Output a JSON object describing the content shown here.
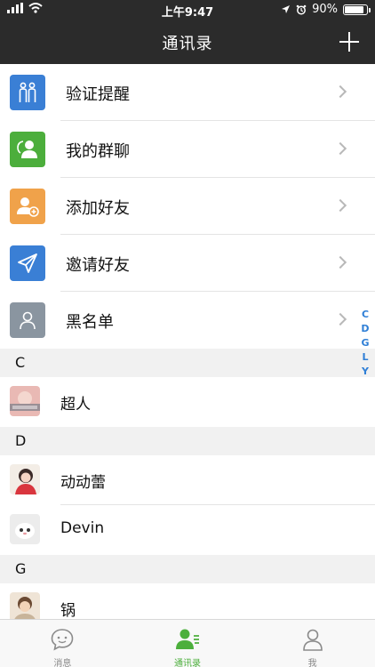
{
  "status_bar": {
    "time": "上午9:47",
    "battery": "90%",
    "battery_level": 0.9
  },
  "nav": {
    "title": "通讯录",
    "add_icon": "plus-icon"
  },
  "functions": [
    {
      "label": "验证提醒",
      "icon": "people-pair-icon",
      "color": "#3a7fd5"
    },
    {
      "label": "我的群聊",
      "icon": "group-chat-icon",
      "color": "#4cae3c"
    },
    {
      "label": "添加好友",
      "icon": "add-friend-icon",
      "color": "#f0a24a"
    },
    {
      "label": "邀请好友",
      "icon": "paper-plane-icon",
      "color": "#3a7fd5"
    },
    {
      "label": "黑名单",
      "icon": "person-outline-icon",
      "color": "#8a95a0"
    }
  ],
  "sections": [
    {
      "letter": "C",
      "contacts": [
        {
          "name": "超人"
        }
      ]
    },
    {
      "letter": "D",
      "contacts": [
        {
          "name": "动动蕾"
        },
        {
          "name": "Devin"
        }
      ]
    },
    {
      "letter": "G",
      "contacts": [
        {
          "name": "锅"
        }
      ]
    }
  ],
  "index_letters": [
    "C",
    "D",
    "G",
    "L",
    "Y"
  ],
  "tabs": [
    {
      "label": "消息",
      "icon": "chat-bubble-icon",
      "active": false
    },
    {
      "label": "通讯录",
      "icon": "contacts-icon",
      "active": true
    },
    {
      "label": "我",
      "icon": "person-icon",
      "active": false
    }
  ],
  "colors": {
    "bar_background": "#2b2b2b",
    "accent_green": "#4caf3c",
    "index_blue": "#2f7fd6"
  }
}
